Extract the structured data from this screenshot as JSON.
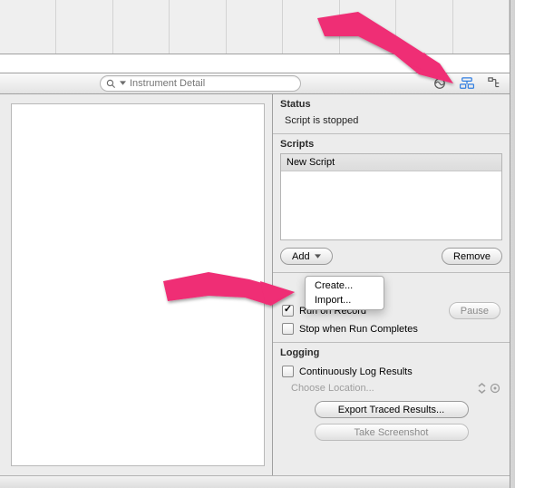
{
  "search": {
    "placeholder": "Instrument Detail"
  },
  "panel": {
    "status": {
      "header": "Status",
      "text": "Script is stopped"
    },
    "scripts": {
      "header": "Scripts",
      "items": [
        "New Script"
      ],
      "add_label": "Add",
      "remove_label": "Remove"
    },
    "add_menu": {
      "create": "Create...",
      "import": "Import..."
    },
    "script_options": {
      "run_on_record": "Run on Record",
      "stop_when_run_completes": "Stop when Run Completes",
      "pause": "Pause"
    },
    "logging": {
      "header": "Logging",
      "continuous": "Continuously Log Results",
      "choose_location": "Choose Location...",
      "export": "Export Traced Results...",
      "screenshot": "Take Screenshot"
    }
  }
}
